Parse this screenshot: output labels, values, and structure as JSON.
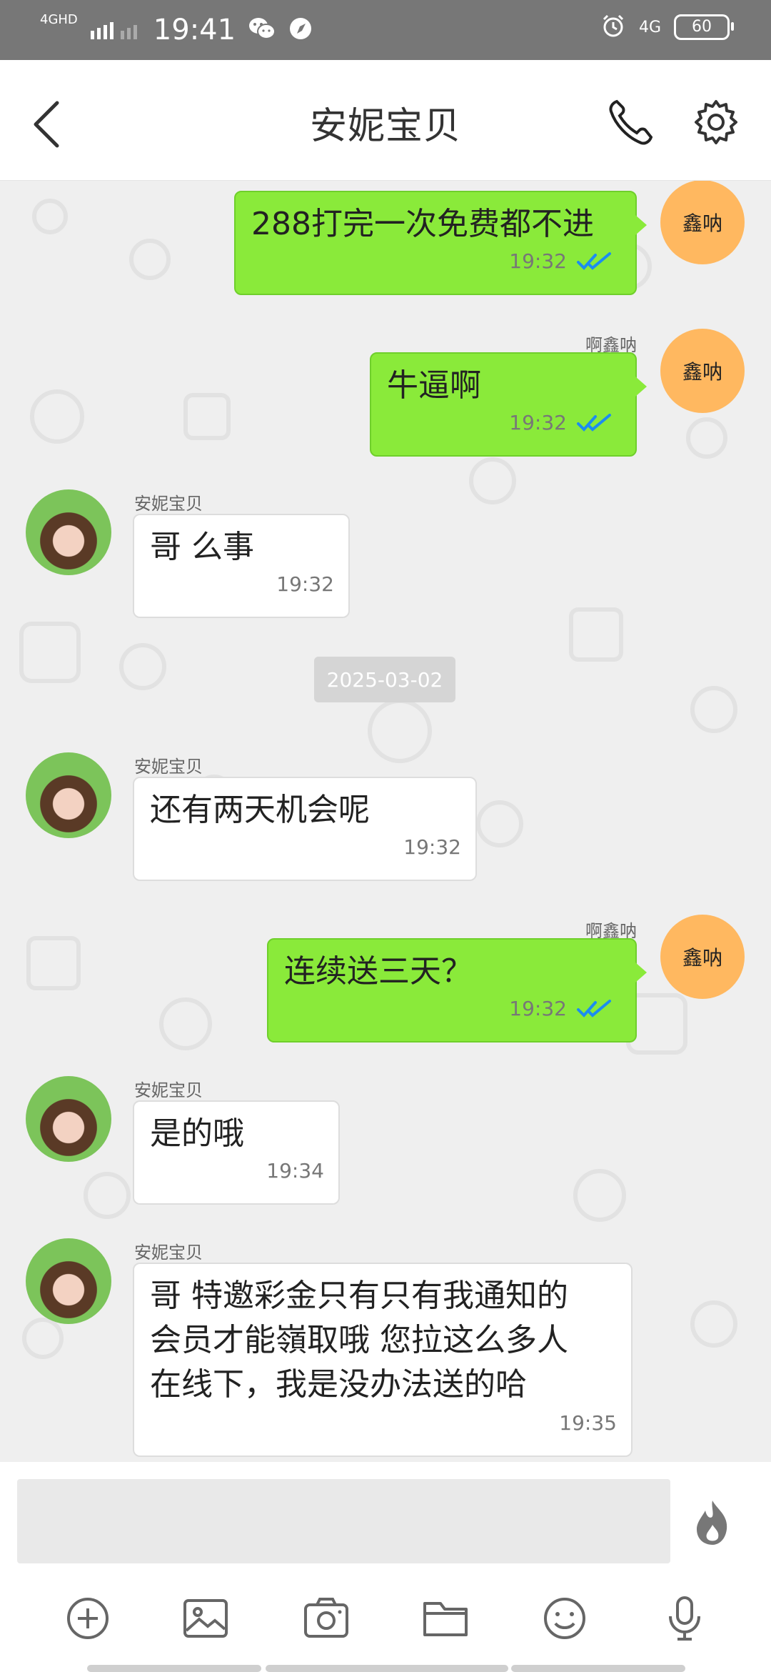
{
  "status_bar": {
    "network_label": "4GHD",
    "time": "19:41",
    "right_network": "4G",
    "battery": "60"
  },
  "header": {
    "title": "安妮宝贝"
  },
  "chat": {
    "messages": [
      {
        "side": "out",
        "sender": "啊鑫呐",
        "avatar": "鑫呐",
        "text": "288打完一次免费都不进",
        "time": "19:32"
      },
      {
        "side": "out",
        "sender": "啊鑫呐",
        "avatar": "鑫呐",
        "text": "牛逼啊",
        "time": "19:32"
      },
      {
        "side": "in",
        "sender": "安妮宝贝",
        "text": "哥 么事",
        "time": "19:32"
      },
      {
        "date": "2025-03-02"
      },
      {
        "side": "in",
        "sender": "安妮宝贝",
        "text": "还有两天机会呢",
        "time": "19:32"
      },
      {
        "side": "out",
        "sender": "啊鑫呐",
        "avatar": "鑫呐",
        "text": "连续送三天？",
        "time": "19:32"
      },
      {
        "side": "in",
        "sender": "安妮宝贝",
        "text": "是的哦",
        "time": "19:34"
      },
      {
        "side": "in",
        "sender": "安妮宝贝",
        "text_lines": [
          "哥 特邀彩金只有只有我通知的",
          "会员才能嶺取哦  您拉这么多人",
          "在线下，我是没办法送的哈"
        ],
        "time": "19:35"
      }
    ]
  },
  "input": {
    "placeholder": ""
  },
  "toolbar_icons": [
    "plus-circle-icon",
    "image-icon",
    "camera-icon",
    "folder-icon",
    "emoji-icon",
    "microphone-icon"
  ],
  "colors": {
    "outgoing_bubble": "#8aea3a",
    "incoming_bubble": "#ffffff",
    "avatar_bg": "#ffb860",
    "read_check": "#1c8cf0"
  }
}
